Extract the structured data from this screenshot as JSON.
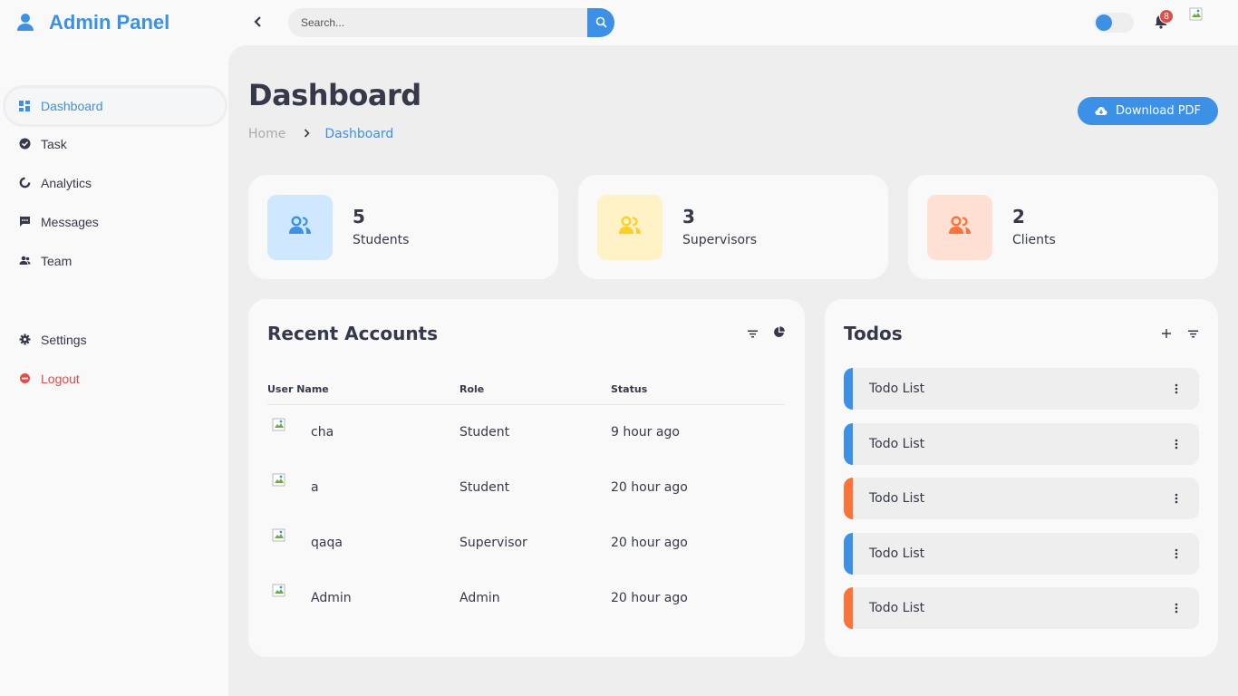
{
  "brand": {
    "title": "Admin Panel",
    "icon": "user-icon",
    "color": "#3c91e6"
  },
  "search": {
    "placeholder": "Search...",
    "value": ""
  },
  "notifications": {
    "count": "8"
  },
  "theme_toggle": {
    "on": false
  },
  "sidebar": {
    "items": [
      {
        "label": "Dashboard",
        "icon": "dashboard-icon",
        "active": true
      },
      {
        "label": "Task",
        "icon": "check-circle-icon"
      },
      {
        "label": "Analytics",
        "icon": "analytics-icon"
      },
      {
        "label": "Messages",
        "icon": "message-icon"
      },
      {
        "label": "Team",
        "icon": "team-icon"
      }
    ],
    "bottom": [
      {
        "label": "Settings",
        "icon": "gear-icon"
      },
      {
        "label": "Logout",
        "icon": "logout-icon"
      }
    ]
  },
  "header": {
    "title": "Dashboard",
    "breadcrumb": {
      "home": "Home",
      "current": "Dashboard"
    },
    "download_label": "Download PDF"
  },
  "stats": [
    {
      "value": "5",
      "label": "Students",
      "icon_color": "#3c91e6",
      "bg": "#cfe8ff"
    },
    {
      "value": "3",
      "label": "Supervisors",
      "icon_color": "#ffce26",
      "bg": "#fff2c6"
    },
    {
      "value": "2",
      "label": "Clients",
      "icon_color": "#fd7238",
      "bg": "#ffe0d3"
    }
  ],
  "recent_accounts": {
    "title": "Recent Accounts",
    "columns": [
      "User Name",
      "Role",
      "Status"
    ],
    "rows": [
      {
        "name": "cha",
        "role": "Student",
        "status": "9 hour ago"
      },
      {
        "name": "a",
        "role": "Student",
        "status": "20 hour ago"
      },
      {
        "name": "qaqa",
        "role": "Supervisor",
        "status": "20 hour ago"
      },
      {
        "name": "Admin",
        "role": "Admin",
        "status": "20 hour ago"
      }
    ]
  },
  "todos": {
    "title": "Todos",
    "items": [
      {
        "label": "Todo List",
        "color": "#3c91e6"
      },
      {
        "label": "Todo List",
        "color": "#3c91e6"
      },
      {
        "label": "Todo List",
        "color": "#fd7238"
      },
      {
        "label": "Todo List",
        "color": "#3c91e6"
      },
      {
        "label": "Todo List",
        "color": "#fd7238"
      }
    ]
  }
}
